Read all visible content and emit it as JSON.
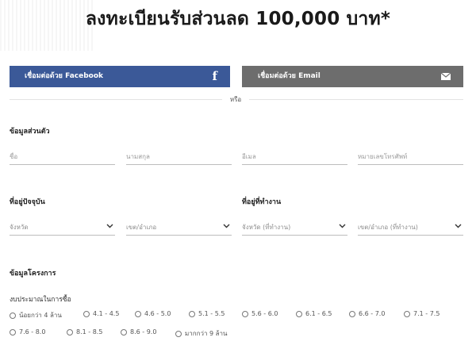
{
  "title": "ลงทะเบียนรับส่วนลด 100,000 บาท*",
  "buttons": {
    "facebook": "เชื่อมต่อด้วย Facebook",
    "email": "เชื่อมต่อด้วย Email"
  },
  "or_label": "หรือ",
  "personal": {
    "heading": "ข้อมูลส่วนตัว",
    "fields": [
      "ชื่อ",
      "นามสกุล",
      "อีเมล",
      "หมายเลขโทรศัพท์"
    ]
  },
  "home": {
    "heading": "ที่อยู่ปัจจุบัน",
    "province": "จังหวัด",
    "district": "เขต/อำเภอ"
  },
  "work": {
    "heading": "ที่อยู่ที่ทำงาน",
    "province": "จังหวัด (ที่ทำงาน)",
    "district": "เขต/อำเภอ (ที่ทำงาน)"
  },
  "project": {
    "heading": "ข้อมูลโครงการ",
    "budget_label": "งบประมาณในการซื้อ",
    "budget_options": [
      "น้อยกว่า 4 ล้าน",
      "4.1 - 4.5",
      "4.6 - 5.0",
      "5.1 - 5.5",
      "5.6 - 6.0",
      "6.1 - 6.5",
      "6.6 - 7.0",
      "7.1 - 7.5",
      "7.6 - 8.0",
      "8.1 - 8.5",
      "8.6 - 9.0",
      "มากกว่า 9 ล้าน"
    ]
  },
  "colors": {
    "facebook": "#3b5998",
    "email": "#6d6d6d"
  }
}
